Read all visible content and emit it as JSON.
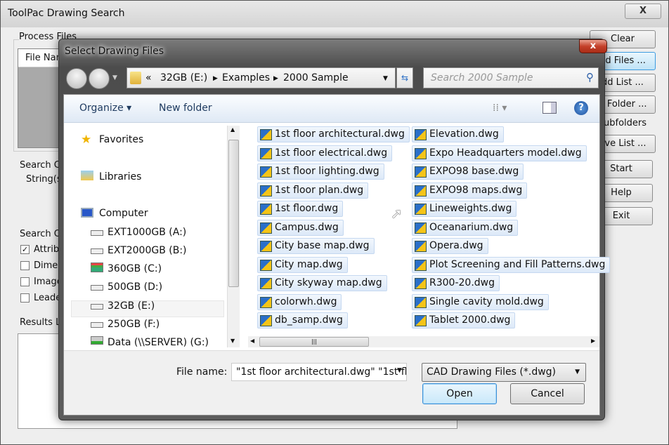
{
  "outer": {
    "title": "ToolPac Drawing Search",
    "close": "X",
    "process_files": "Process Files",
    "file_name_header": "File Nam",
    "search_criteria": "Search C",
    "strings": "String(s)",
    "search_options": "Search O",
    "options": [
      {
        "label": "Attribu",
        "checked": true
      },
      {
        "label": "Dimen",
        "checked": false
      },
      {
        "label": "Image",
        "checked": false
      },
      {
        "label": "Leade",
        "checked": false
      }
    ],
    "results": "Results L",
    "buttons": {
      "clear": "Clear",
      "add_files": "dd Files ...",
      "add_list": "dd List ...",
      "add_folder": "d Folder ...",
      "subfolders": "ubfolders",
      "save_list": "ave List ...",
      "start": "Start",
      "help": "Help",
      "exit": "Exit"
    }
  },
  "dialog": {
    "title": "Select Drawing Files",
    "close": "x",
    "breadcrumb": [
      "«",
      "32GB (E:)",
      "Examples",
      "2000 Sample"
    ],
    "search_placeholder": "Search 2000 Sample",
    "toolbar": {
      "organize": "Organize ▾",
      "new_folder": "New folder"
    },
    "nav": {
      "favorites": "Favorites",
      "libraries": "Libraries",
      "computer": "Computer",
      "drives": [
        "EXT1000GB (A:)",
        "EXT2000GB (B:)",
        "360GB (C:)",
        "500GB (D:)",
        "32GB (E:)",
        "250GB (F:)",
        "Data (\\\\SERVER) (G:)"
      ]
    },
    "files_col1": [
      "1st floor architectural.dwg",
      "1st floor electrical.dwg",
      "1st floor lighting.dwg",
      "1st floor plan.dwg",
      "1st floor.dwg",
      "Campus.dwg",
      "City base map.dwg",
      "City map.dwg",
      "City skyway map.dwg",
      "colorwh.dwg",
      "db_samp.dwg"
    ],
    "files_col2": [
      "Elevation.dwg",
      "Expo Headquarters model.dwg",
      "EXPO98 base.dwg",
      "EXPO98 maps.dwg",
      "Lineweights.dwg",
      "Oceanarium.dwg",
      "Opera.dwg",
      "Plot Screening and Fill Patterns.dwg",
      "R300-20.dwg",
      "Single cavity mold.dwg",
      "Tablet 2000.dwg"
    ],
    "file_name_label": "File name:",
    "file_name_value": "\"1st floor architectural.dwg\" \"1st fl",
    "file_type": "CAD Drawing Files (*.dwg)",
    "open": "Open",
    "cancel": "Cancel"
  }
}
